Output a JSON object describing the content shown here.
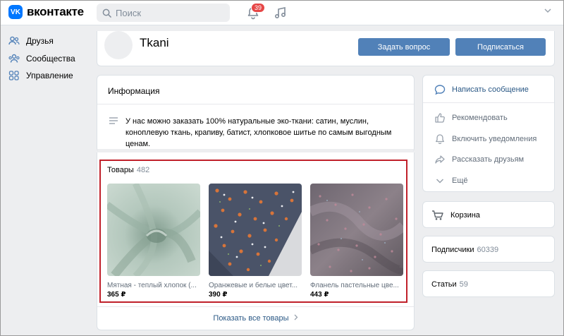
{
  "app": {
    "logo_text": "вконтакте",
    "logo_mark": "VK"
  },
  "search": {
    "placeholder": "Поиск"
  },
  "notifications": {
    "badge": "39"
  },
  "sidebar": {
    "items": [
      {
        "label": "Друзья",
        "icon": "friends-icon"
      },
      {
        "label": "Сообщества",
        "icon": "communities-icon"
      },
      {
        "label": "Управление",
        "icon": "manage-icon"
      }
    ]
  },
  "group": {
    "name": "Tkani",
    "ask_label": "Задать вопрос",
    "subscribe_label": "Подписаться"
  },
  "info": {
    "title": "Информация",
    "text": "У нас можно заказать 100% натуральные эко-ткани: сатин, муслин, коноплевую ткань, крапиву, батист, хлопковое шитье по самым выгодным ценам."
  },
  "goods": {
    "title": "Товары",
    "count": "482",
    "items": [
      {
        "name": "Мятная - теплый хлопок (...",
        "price": "365 ₽"
      },
      {
        "name": "Оранжевые и белые цвет...",
        "price": "390 ₽"
      },
      {
        "name": "Фланель пастельные цве...",
        "price": "443 ₽"
      }
    ],
    "show_all": "Показать все товары"
  },
  "actions": {
    "message": "Написать сообщение",
    "recommend": "Рекомендовать",
    "notify": "Включить уведомления",
    "share": "Рассказать друзьям",
    "more": "Ещё"
  },
  "cart": {
    "label": "Корзина"
  },
  "subscribers": {
    "label": "Подписчики",
    "count": "60339"
  },
  "articles": {
    "label": "Статьи",
    "count": "59"
  },
  "colors": {
    "accent": "#5181b8",
    "link": "#2a5885",
    "badge": "#e64646",
    "highlight": "#c0202a"
  }
}
